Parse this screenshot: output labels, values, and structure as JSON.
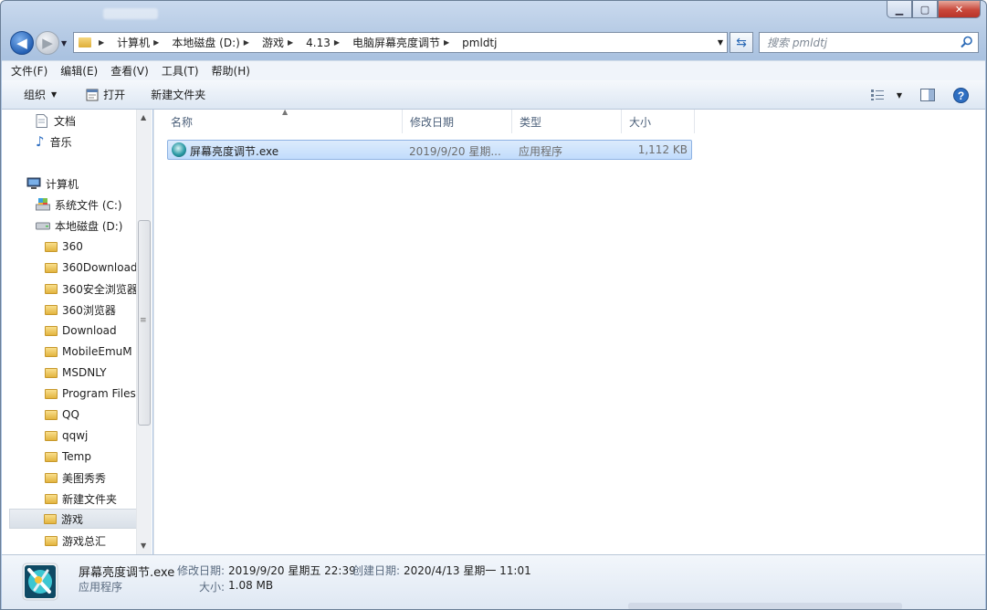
{
  "window": {
    "controls": {
      "minimize": "▁",
      "maximize": "▢",
      "close": "✕"
    }
  },
  "address": {
    "crumbs": [
      "计算机",
      "本地磁盘 (D:)",
      "游戏",
      "4.13",
      "电脑屏幕亮度调节",
      "pmldtj"
    ],
    "search_placeholder": "搜索 pmldtj"
  },
  "menu": [
    "文件(F)",
    "编辑(E)",
    "查看(V)",
    "工具(T)",
    "帮助(H)"
  ],
  "toolbar": {
    "organize": "组织",
    "open": "打开",
    "new_folder": "新建文件夹"
  },
  "nav": {
    "documents": "文档",
    "music": "音乐",
    "computer": "计算机",
    "drive_c": "系统文件 (C:)",
    "drive_d": "本地磁盘 (D:)",
    "folders": [
      "360",
      "360Download",
      "360安全浏览器",
      "360浏览器",
      "Download",
      "MobileEmuM",
      "MSDNLY",
      "Program Files",
      "QQ",
      "qqwj",
      "Temp",
      "美图秀秀",
      "新建文件夹",
      "游戏",
      "游戏总汇"
    ],
    "selected": "游戏"
  },
  "columns": {
    "name": "名称",
    "modified": "修改日期",
    "type": "类型",
    "size": "大小"
  },
  "files": [
    {
      "name": "屏幕亮度调节.exe",
      "modified": "2019/9/20 星期...",
      "type": "应用程序",
      "size": "1,112 KB"
    }
  ],
  "details": {
    "filename": "屏幕亮度调节.exe",
    "filetype": "应用程序",
    "modified_label": "修改日期:",
    "modified_value": "2019/9/20 星期五 22:39",
    "created_label": "创建日期:",
    "created_value": "2020/4/13 星期一 11:01",
    "size_label": "大小:",
    "size_value": "1.08 MB"
  },
  "colors": {
    "accent": "#2460b4",
    "selection": "#c1dcfc",
    "folder": "#e2b43f"
  }
}
